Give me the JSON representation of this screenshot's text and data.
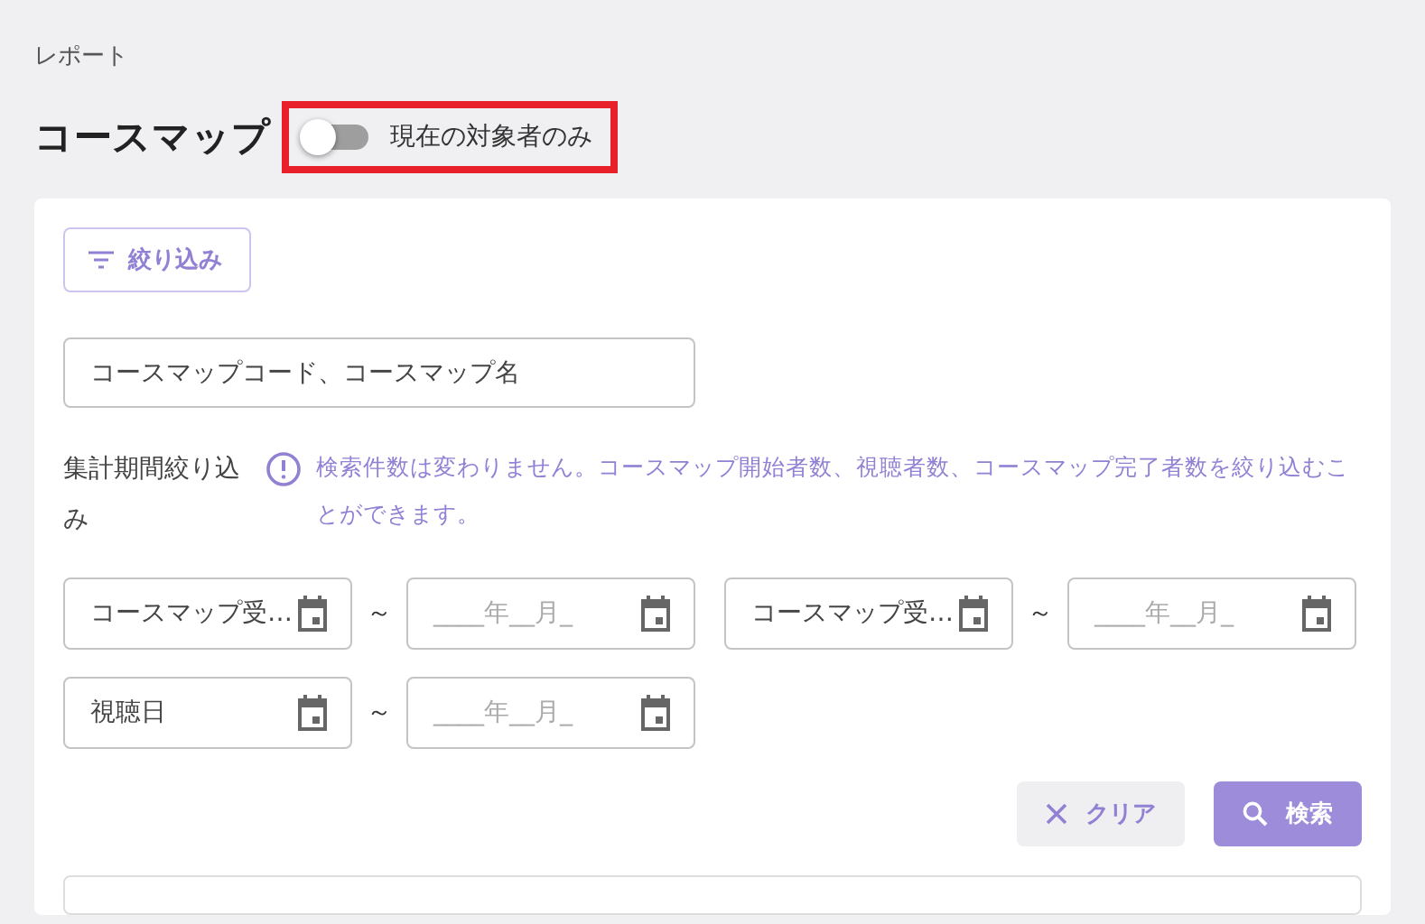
{
  "breadcrumb": "レポート",
  "title": "コースマップ",
  "toggle": {
    "label": "現在の対象者のみ",
    "on": false,
    "highlighted": true
  },
  "filter_button": "絞り込み",
  "search": {
    "placeholder": "コースマップコード、コースマップ名"
  },
  "period": {
    "label": "集計期間絞り込み",
    "note": "検索件数は変わりません。コースマップ開始者数、視聴者数、コースマップ完了者数を絞り込むことができます。"
  },
  "date_ranges": [
    {
      "from": {
        "value": "コースマップ受…"
      },
      "separator": "～",
      "to": {
        "placeholder": "____年__月_"
      }
    },
    {
      "from": {
        "value": "コースマップ受…"
      },
      "separator": "～",
      "to": {
        "placeholder": "____年__月_"
      }
    },
    {
      "from": {
        "value": "視聴日"
      },
      "separator": "～",
      "to": {
        "placeholder": "____年__月_"
      }
    }
  ],
  "buttons": [
    {
      "kind": "clear",
      "label": "クリア"
    },
    {
      "kind": "search",
      "label": "検索"
    }
  ]
}
